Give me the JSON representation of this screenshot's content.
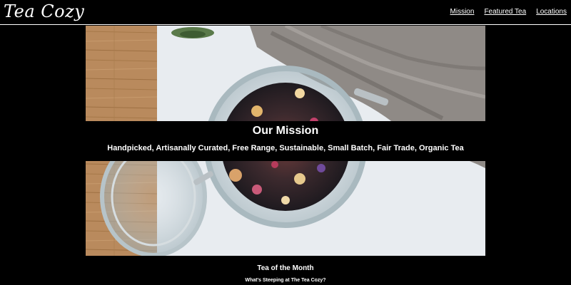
{
  "header": {
    "logo": "Tea Cozy",
    "nav": [
      "Mission",
      "Featured Tea",
      "Locations"
    ]
  },
  "hero": {
    "image": "photo of an open glass jar filled with loose-leaf tea with dried flower petals, on a white table beside a wooden board and a grey knitted cloth"
  },
  "mission": {
    "title": "Our Mission",
    "subtitle": "Handpicked, Artisanally Curated, Free Range, Sustainable, Small Batch, Fair Trade, Organic Tea"
  },
  "featured": {
    "heading": "Tea of the Month",
    "subheading": "What's Steeping at The Tea Cozy?"
  },
  "colors": {
    "background": "#000000",
    "text": "#ffffff"
  }
}
